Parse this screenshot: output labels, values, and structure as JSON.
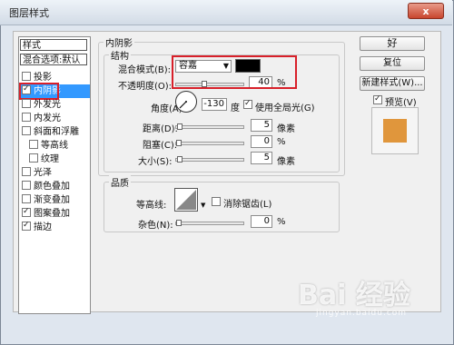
{
  "window": {
    "title": "图层样式",
    "close_label": "x"
  },
  "styles_list": {
    "header": "样式",
    "blend_options": "混合选项:默认",
    "items": [
      {
        "label": "投影",
        "checked": false
      },
      {
        "label": "内阴影",
        "checked": true,
        "selected": true
      },
      {
        "label": "外发光",
        "checked": false
      },
      {
        "label": "内发光",
        "checked": false
      },
      {
        "label": "斜面和浮雕",
        "checked": false
      },
      {
        "label": "等高线",
        "checked": false,
        "indent": true
      },
      {
        "label": "纹理",
        "checked": false,
        "indent": true
      },
      {
        "label": "光泽",
        "checked": false
      },
      {
        "label": "颜色叠加",
        "checked": false
      },
      {
        "label": "渐变叠加",
        "checked": false
      },
      {
        "label": "图案叠加",
        "checked": true
      },
      {
        "label": "描边",
        "checked": true
      }
    ]
  },
  "inner_shadow": {
    "section_title": "内阴影",
    "structure_title": "结构",
    "blend_mode_label": "混合模式(B):",
    "blend_mode_value": "容嘉",
    "shadow_color": "#000000",
    "opacity_label": "不透明度(O):",
    "opacity_value": "40",
    "opacity_unit": "%",
    "opacity_level": 0.4,
    "angle_label": "角度(A):",
    "angle_value": "-130",
    "angle_unit": "度",
    "global_light_label": "使用全局光(G)",
    "global_light_checked": true,
    "distance_label": "距离(D):",
    "distance_value": "5",
    "distance_unit": "像素",
    "choke_label": "阻塞(C):",
    "choke_value": "0",
    "choke_unit": "%",
    "size_label": "大小(S):",
    "size_value": "5",
    "size_unit": "像素"
  },
  "quality": {
    "title": "品质",
    "contour_label": "等高线:",
    "anti_alias_label": "消除锯齿(L)",
    "anti_alias_checked": false,
    "noise_label": "杂色(N):",
    "noise_value": "0",
    "noise_unit": "%"
  },
  "buttons": {
    "ok": "好",
    "reset": "复位",
    "new_style": "新建样式(W)...",
    "preview_label": "预览(V)",
    "preview_checked": true
  },
  "preview_color": "#e0963c",
  "watermark": {
    "text": "Bai 经验",
    "sub": "jingyan.baidu.com"
  }
}
